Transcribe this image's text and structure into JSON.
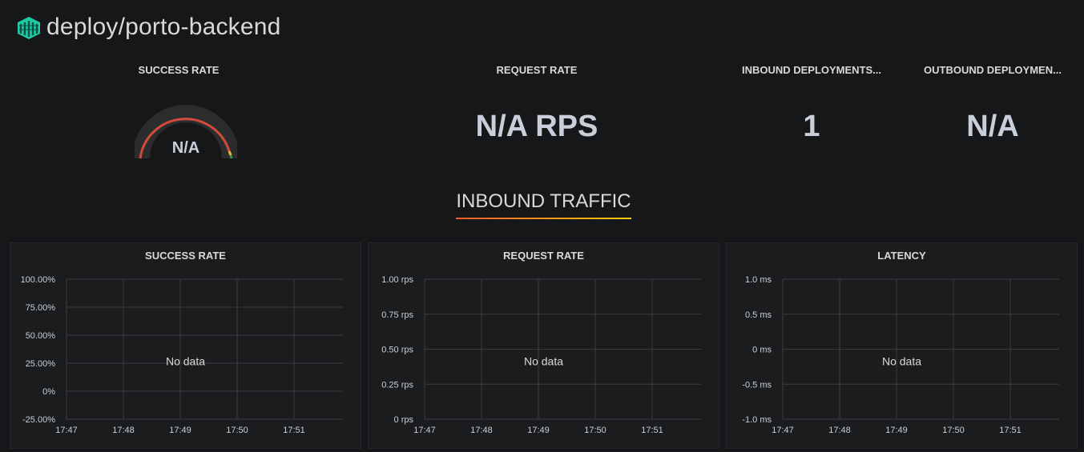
{
  "header": {
    "title": "deploy/porto-backend",
    "logo_icon": "linkerd-logo-icon"
  },
  "stats": {
    "success_rate": {
      "label": "SUCCESS RATE",
      "value": "N/A"
    },
    "request_rate": {
      "label": "REQUEST RATE",
      "value": "N/A RPS"
    },
    "inbound": {
      "label": "INBOUND DEPLOYMENTS...",
      "value": "1"
    },
    "outbound": {
      "label": "OUTBOUND DEPLOYMEN...",
      "value": "N/A"
    }
  },
  "colors": {
    "accent": "#f05a28",
    "gauge_red": "#d44a3a",
    "gauge_orange": "#eab839",
    "gauge_green": "#299c46"
  },
  "row": {
    "title": "INBOUND TRAFFIC"
  },
  "chart_data": [
    {
      "type": "line",
      "title": "SUCCESS RATE",
      "x": [
        "17:47",
        "17:48",
        "17:49",
        "17:50",
        "17:51"
      ],
      "y_ticks": [
        "100.00%",
        "75.00%",
        "50.00%",
        "25.00%",
        "0%",
        "-25.00%"
      ],
      "series": [],
      "annotation": "No data",
      "grid": true
    },
    {
      "type": "line",
      "title": "REQUEST RATE",
      "x": [
        "17:47",
        "17:48",
        "17:49",
        "17:50",
        "17:51"
      ],
      "y_ticks": [
        "1.00 rps",
        "0.75 rps",
        "0.50 rps",
        "0.25 rps",
        "0 rps"
      ],
      "series": [],
      "annotation": "No data",
      "grid": true
    },
    {
      "type": "line",
      "title": "LATENCY",
      "x": [
        "17:47",
        "17:48",
        "17:49",
        "17:50",
        "17:51"
      ],
      "y_ticks": [
        "1.0 ms",
        "0.5 ms",
        "0 ms",
        "-0.5 ms",
        "-1.0 ms"
      ],
      "series": [],
      "annotation": "No data",
      "grid": true
    }
  ]
}
